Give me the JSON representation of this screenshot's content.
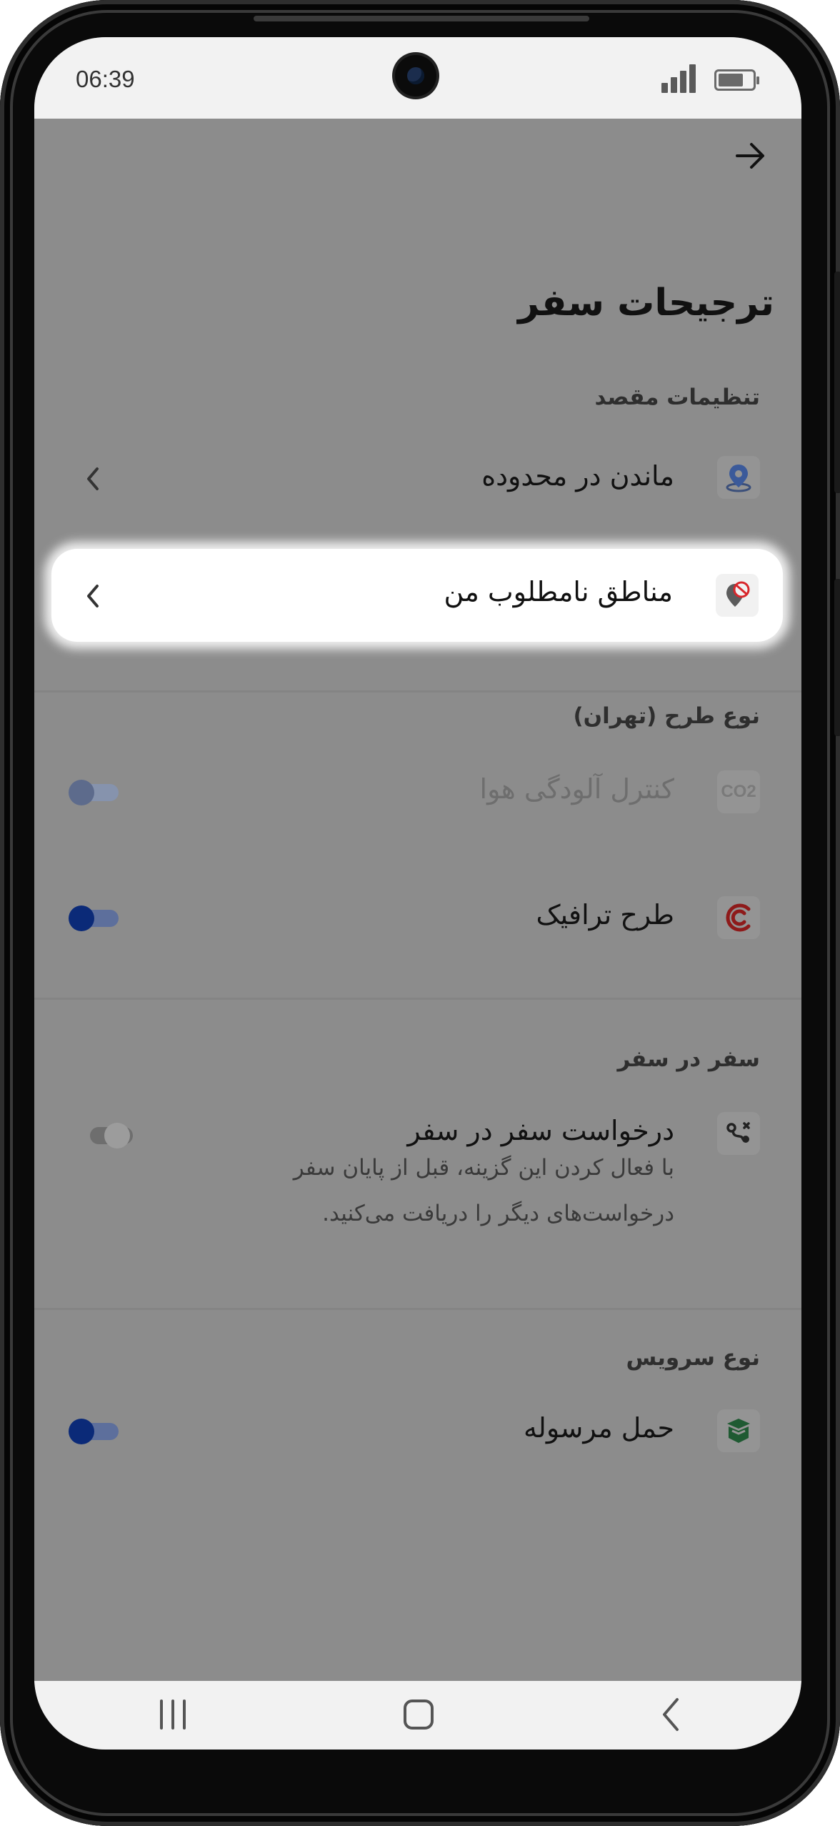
{
  "status_bar": {
    "time": "06:39"
  },
  "header": {
    "title": "ترجیحات سفر"
  },
  "sections": {
    "destination": {
      "title": "تنظیمات مقصد",
      "items": [
        {
          "label": "ماندن در محدوده",
          "icon": "location-pin-icon"
        },
        {
          "label": "مناطق نامطلوب من",
          "icon": "blocked-location-icon",
          "highlighted": true
        }
      ]
    },
    "scheme": {
      "title": "نوع طرح (تهران)",
      "items": [
        {
          "label": "کنترل آلودگی هوا",
          "icon": "co2-icon",
          "icon_text": "CO2",
          "toggle_on": true,
          "disabled": true
        },
        {
          "label": "طرح ترافیک",
          "icon": "traffic-c-icon",
          "toggle_on": true
        }
      ]
    },
    "trip": {
      "title": "سفر در سفر",
      "items": [
        {
          "label": "درخواست سفر در سفر",
          "icon": "route-icon",
          "toggle_on": false,
          "description_line1": "با فعال کردن این گزینه، قبل از پایان سفر",
          "description_line2": "درخواست‌های دیگر را دریافت می‌کنید."
        }
      ]
    },
    "service": {
      "title": "نوع سرویس",
      "items": [
        {
          "label": "حمل مرسوله",
          "icon": "parcel-box-icon",
          "toggle_on": true
        }
      ]
    }
  },
  "colors": {
    "overlay_bg": "#8c8c8c",
    "toggle_on_knob": "#0b2a78",
    "toggle_on_track": "#5d6f9c",
    "traffic_icon": "#8e1a1a",
    "parcel_icon": "#1f5a32"
  }
}
